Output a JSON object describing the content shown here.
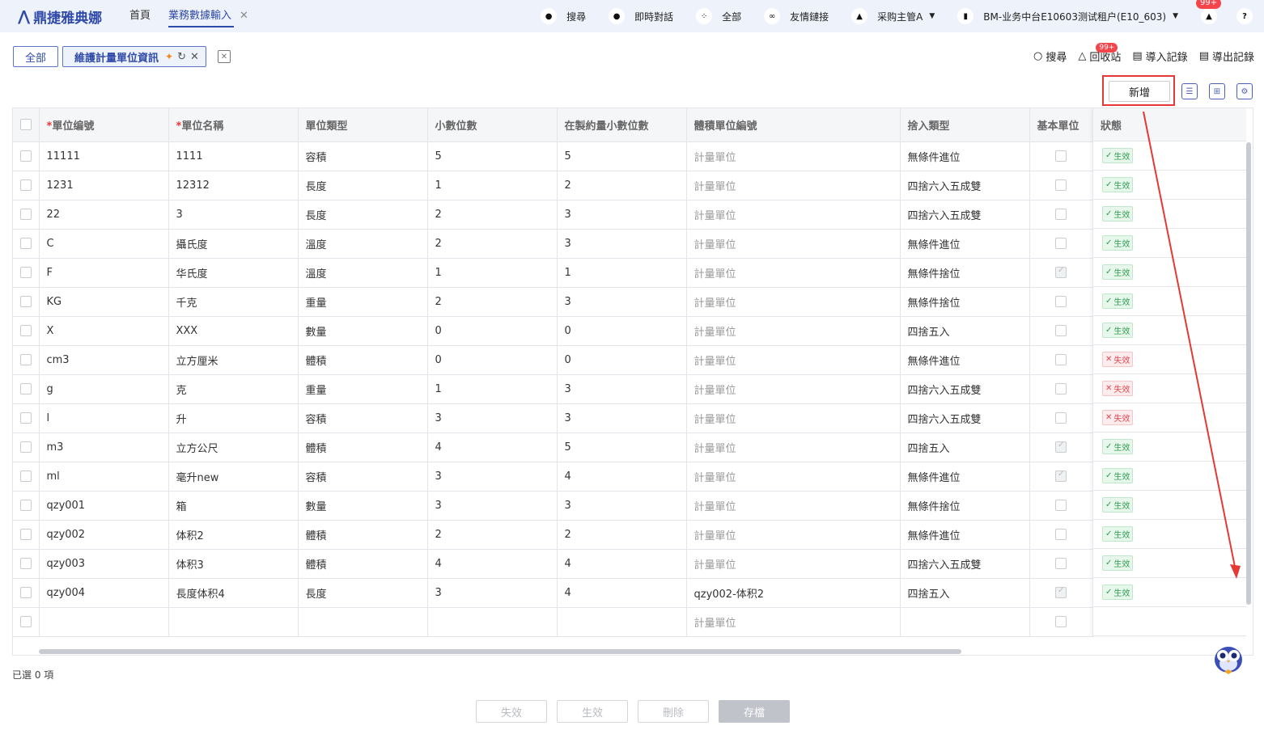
{
  "app": {
    "logo_text": "鼎捷雅典娜"
  },
  "nav": {
    "home": "首頁",
    "active_tab": "業務數據輸入",
    "close": "✕"
  },
  "top": {
    "search": "搜尋",
    "chat": "即時對話",
    "all": "全部",
    "links": "友情鏈接",
    "user": "采购主管A",
    "tenant": "BM-业务中台E10603测试租户(E10_603)",
    "notify_badge": "99+"
  },
  "subtabs": {
    "all": "全部",
    "active": "維護計量單位資訊"
  },
  "actions": {
    "search": "搜尋",
    "recycle": "回收站",
    "recycle_badge": "99+",
    "import": "導入記錄",
    "export": "導出記錄"
  },
  "toolbar": {
    "add": "新增"
  },
  "table": {
    "headers": [
      "單位编號",
      "單位名稱",
      "單位類型",
      "小數位數",
      "在製約量小數位數",
      "體積單位編號",
      "捨入類型",
      "基本單位",
      "狀態"
    ],
    "required_mark": "*",
    "rows": [
      {
        "code": "11111",
        "name": "1111",
        "type": "容積",
        "dec": "5",
        "wip": "5",
        "vol": "計量單位",
        "round": "無條件進位",
        "basic": false,
        "status": "生效",
        "ok": true
      },
      {
        "code": "1231",
        "name": "12312",
        "type": "長度",
        "dec": "1",
        "wip": "2",
        "vol": "計量單位",
        "round": "四捨六入五成雙",
        "basic": false,
        "status": "生效",
        "ok": true
      },
      {
        "code": "22",
        "name": "3",
        "type": "長度",
        "dec": "2",
        "wip": "3",
        "vol": "計量單位",
        "round": "四捨六入五成雙",
        "basic": false,
        "status": "生效",
        "ok": true
      },
      {
        "code": "C",
        "name": "攝氏度",
        "type": "溫度",
        "dec": "2",
        "wip": "3",
        "vol": "計量單位",
        "round": "無條件進位",
        "basic": false,
        "status": "生效",
        "ok": true
      },
      {
        "code": "F",
        "name": "华氏度",
        "type": "溫度",
        "dec": "1",
        "wip": "1",
        "vol": "計量單位",
        "round": "無條件捨位",
        "basic": true,
        "status": "生效",
        "ok": true
      },
      {
        "code": "KG",
        "name": "千克",
        "type": "重量",
        "dec": "2",
        "wip": "3",
        "vol": "計量單位",
        "round": "無條件捨位",
        "basic": false,
        "status": "生效",
        "ok": true
      },
      {
        "code": "X",
        "name": "XXX",
        "type": "數量",
        "dec": "0",
        "wip": "0",
        "vol": "計量單位",
        "round": "四捨五入",
        "basic": false,
        "status": "生效",
        "ok": true
      },
      {
        "code": "cm3",
        "name": "立方厘米",
        "type": "體積",
        "dec": "0",
        "wip": "0",
        "vol": "計量單位",
        "round": "無條件進位",
        "basic": false,
        "status": "失效",
        "ok": false
      },
      {
        "code": "g",
        "name": "克",
        "type": "重量",
        "dec": "1",
        "wip": "3",
        "vol": "計量單位",
        "round": "四捨六入五成雙",
        "basic": false,
        "status": "失效",
        "ok": false
      },
      {
        "code": "l",
        "name": "升",
        "type": "容積",
        "dec": "3",
        "wip": "3",
        "vol": "計量單位",
        "round": "四捨六入五成雙",
        "basic": false,
        "status": "失效",
        "ok": false
      },
      {
        "code": "m3",
        "name": "立方公尺",
        "type": "體積",
        "dec": "4",
        "wip": "5",
        "vol": "計量單位",
        "round": "四捨五入",
        "basic": true,
        "status": "生效",
        "ok": true
      },
      {
        "code": "ml",
        "name": "毫升new",
        "type": "容積",
        "dec": "3",
        "wip": "4",
        "vol": "計量單位",
        "round": "無條件進位",
        "basic": true,
        "status": "生效",
        "ok": true
      },
      {
        "code": "qzy001",
        "name": "箱",
        "type": "數量",
        "dec": "3",
        "wip": "3",
        "vol": "計量單位",
        "round": "無條件捨位",
        "basic": false,
        "status": "生效",
        "ok": true
      },
      {
        "code": "qzy002",
        "name": "体积2",
        "type": "體積",
        "dec": "2",
        "wip": "2",
        "vol": "計量單位",
        "round": "無條件進位",
        "basic": false,
        "status": "生效",
        "ok": true
      },
      {
        "code": "qzy003",
        "name": "体积3",
        "type": "體積",
        "dec": "4",
        "wip": "4",
        "vol": "計量單位",
        "round": "四捨六入五成雙",
        "basic": false,
        "status": "生效",
        "ok": true
      },
      {
        "code": "qzy004",
        "name": "長度体积4",
        "type": "長度",
        "dec": "3",
        "wip": "4",
        "vol": "qzy002-体积2",
        "round": "四捨五入",
        "basic": true,
        "status": "生效",
        "ok": true,
        "vol_dark": true
      },
      {
        "code": "",
        "name": "",
        "type": "",
        "dec": "",
        "wip": "",
        "vol": "計量單位",
        "round": "",
        "basic": false,
        "status": "",
        "ok": null
      }
    ]
  },
  "selected_count": "已選 0 項",
  "footer": {
    "disable": "失效",
    "enable": "生效",
    "delete": "刪除",
    "save": "存檔"
  },
  "colors": {
    "brand": "#2f4aa8",
    "annotation": "#e53935"
  }
}
